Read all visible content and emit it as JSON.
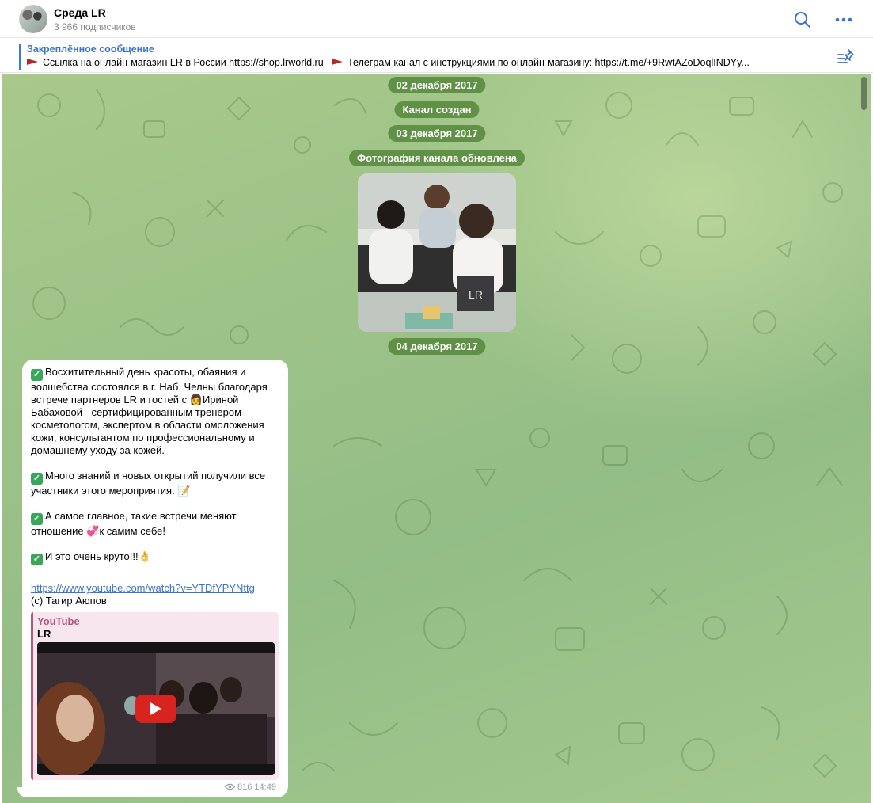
{
  "header": {
    "title": "Среда LR",
    "subtitle": "3 966 подписчиков"
  },
  "pinned": {
    "title": "Закреплённое сообщение",
    "text_part1": "Ссылка на онлайн-магазин LR в России  https://shop.lrworld.ru",
    "text_part2": "Телеграм канал с инструкциями по онлайн-магазину: https://t.me/+9RwtAZoDoqlINDYy..."
  },
  "service_messages": {
    "date1": "02 декабря 2017",
    "created": "Канал создан",
    "date2": "03 декабря 2017",
    "photo_updated": "Фотография канала обновлена",
    "date3": "04 декабря 2017"
  },
  "message": {
    "p1": "Восхитительный день красоты, обаяния и волшебства состоялся в г. Наб. Челны благодаря встрече партнеров LR и гостей с",
    "p1b": "Ириной Бабаховой - сертифицированным тренером-косметологом, экспертом в области омоложения кожи, консультантом по профессиональному и домашнему уходу за кожей.",
    "p2": "Много знаний и новых открытий получили все участники этого мероприятия.",
    "p3a": "А самое главное, такие встречи меняют отношение",
    "p3b": "к самим себе!",
    "p4": "И это очень круто!!!",
    "link": "https://www.youtube.com/watch?v=YTDfYPYNttg",
    "credit": "(с) Тагир Аюпов",
    "preview_site": "YouTube",
    "preview_title": "LR",
    "views": "816",
    "time": "14:49"
  },
  "colors": {
    "accent": "#3a73c8",
    "service_bg": "#528538",
    "preview_accent": "#b8557f",
    "youtube_red": "#d8231f"
  }
}
